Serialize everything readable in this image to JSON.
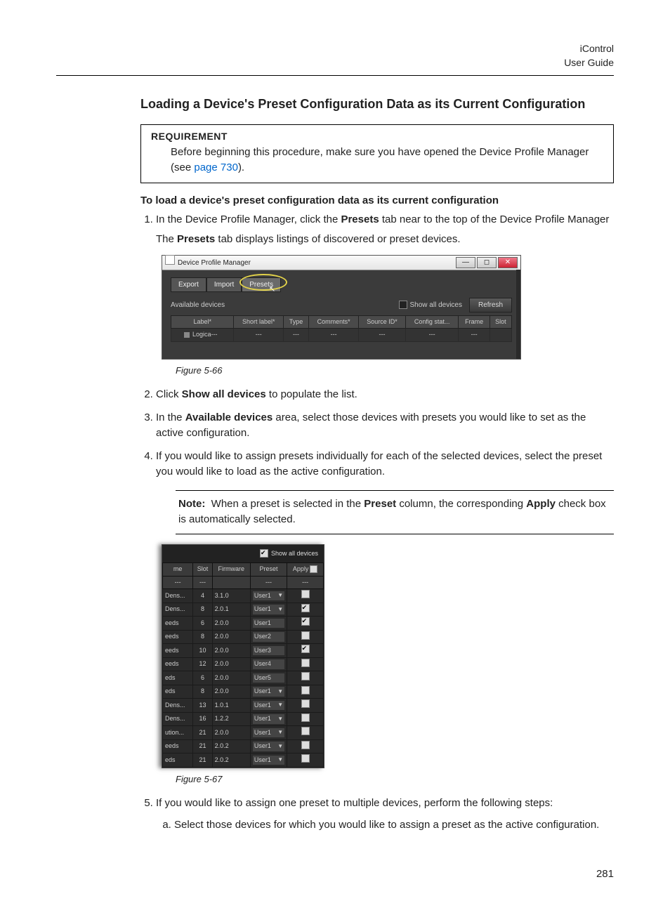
{
  "header": {
    "product": "iControl",
    "doc": "User Guide"
  },
  "title": "Loading a Device's Preset Configuration Data as its Current Configuration",
  "requirement": {
    "label": "REQUIREMENT",
    "text_before": "Before beginning this procedure, make sure you have opened the Device Profile Manager (see ",
    "link": "page 730",
    "text_after": ")."
  },
  "subhead": "To load a device's preset configuration data as its current configuration",
  "steps": {
    "s1a": "In the Device Profile Manager, click the ",
    "s1b": "Presets",
    "s1c": " tab near to the top of the Device Profile Manager",
    "s1p_a": "The ",
    "s1p_b": "Presets",
    "s1p_c": " tab displays listings of discovered or preset devices.",
    "s2a": "Click ",
    "s2b": "Show all devices",
    "s2c": " to populate the list.",
    "s3a": "In the ",
    "s3b": "Available devices",
    "s3c": " area, select those devices with presets you would like to set as the active configuration.",
    "s4": "If you would like to assign presets individually for each of the selected devices, select the preset you would like to load as the active configuration.",
    "s5": "If you would like to assign one preset to multiple devices, perform the following steps:",
    "s5a": "Select those devices for which you would like to assign a preset as the active configuration."
  },
  "note": {
    "label": "Note:",
    "t1": "When a preset is selected in the ",
    "b1": "Preset",
    "t2": " column, the corresponding ",
    "b2": "Apply",
    "t3": " check box is automatically selected."
  },
  "fig66": {
    "caption": "Figure 5-66",
    "window_title": "Device Profile Manager",
    "tabs": {
      "export": "Export",
      "import": "Import",
      "presets": "Presets"
    },
    "avail_label": "Available devices",
    "show_all": "Show all devices",
    "refresh": "Refresh",
    "cols": {
      "label": "Label*",
      "short": "Short label*",
      "type": "Type",
      "comments": "Comments*",
      "source": "Source ID*",
      "config": "Config stat...",
      "frame": "Frame",
      "slot": "Slot"
    },
    "row_label": "Logica---"
  },
  "fig67": {
    "caption": "Figure 5-67",
    "show_all": "Show all devices",
    "cols": {
      "name": "me",
      "slot": "Slot",
      "firmware": "Firmware",
      "preset": "Preset",
      "apply": "Apply"
    },
    "rows": [
      {
        "n": "Dens...",
        "s": "4",
        "f": "3.1.0",
        "p": "User1",
        "dd": true,
        "a": false
      },
      {
        "n": "Dens...",
        "s": "8",
        "f": "2.0.1",
        "p": "User1",
        "dd": true,
        "a": true
      },
      {
        "n": "eeds",
        "s": "6",
        "f": "2.0.0",
        "p": "User1",
        "dd": false,
        "a": true
      },
      {
        "n": "eeds",
        "s": "8",
        "f": "2.0.0",
        "p": "User2",
        "dd": false,
        "a": false
      },
      {
        "n": "eeds",
        "s": "10",
        "f": "2.0.0",
        "p": "User3",
        "dd": false,
        "a": true
      },
      {
        "n": "eeds",
        "s": "12",
        "f": "2.0.0",
        "p": "User4",
        "dd": false,
        "a": false
      },
      {
        "n": "eds",
        "s": "6",
        "f": "2.0.0",
        "p": "User5",
        "dd": false,
        "a": false
      },
      {
        "n": "eds",
        "s": "8",
        "f": "2.0.0",
        "p": "User1",
        "dd": true,
        "a": false
      },
      {
        "n": "Dens...",
        "s": "13",
        "f": "1.0.1",
        "p": "User1",
        "dd": true,
        "a": false
      },
      {
        "n": "Dens...",
        "s": "16",
        "f": "1.2.2",
        "p": "User1",
        "dd": true,
        "a": false
      },
      {
        "n": "ution...",
        "s": "21",
        "f": "2.0.0",
        "p": "User1",
        "dd": true,
        "a": false
      },
      {
        "n": "eeds",
        "s": "21",
        "f": "2.0.2",
        "p": "User1",
        "dd": true,
        "a": false
      },
      {
        "n": "eds",
        "s": "21",
        "f": "2.0.2",
        "p": "User1",
        "dd": true,
        "a": false
      }
    ]
  },
  "page_number": "281"
}
